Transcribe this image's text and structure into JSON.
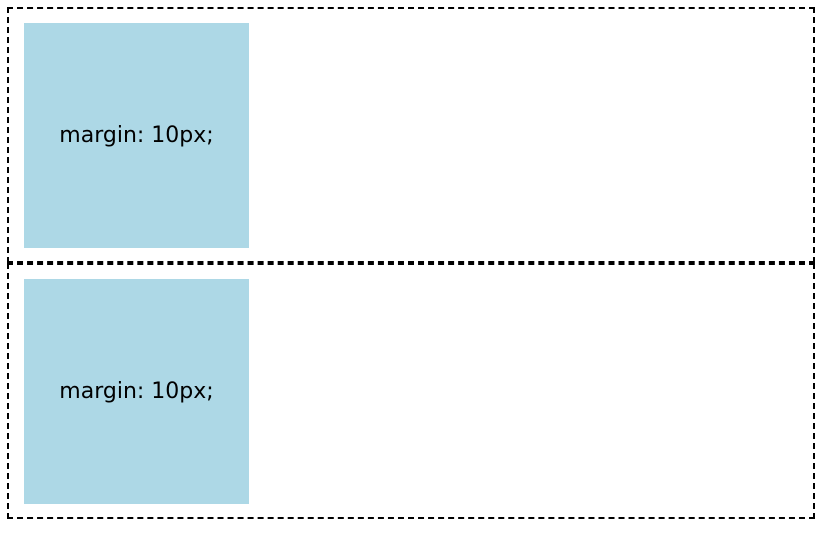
{
  "colors": {
    "box_background": "#add8e6",
    "border": "#000000"
  },
  "containers": [
    {
      "box_label": "margin: 10px;"
    },
    {
      "box_label": "margin: 10px;"
    }
  ]
}
